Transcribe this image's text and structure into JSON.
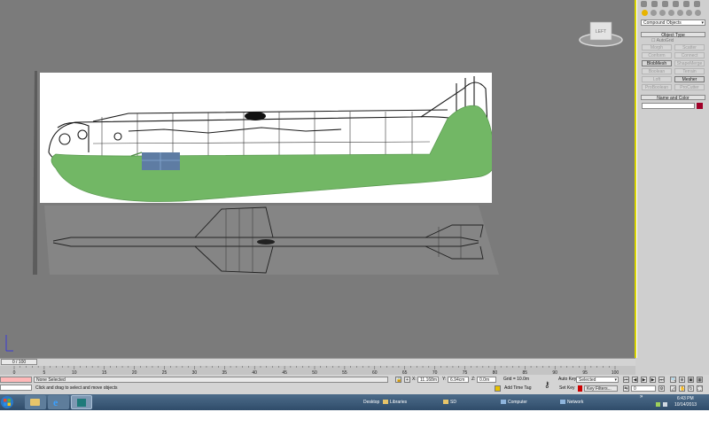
{
  "viewport": {
    "label": "",
    "viewcube_label": "LEFT"
  },
  "command_panel": {
    "category_dropdown": "Compound Objects",
    "object_type_header": "Object Type",
    "autogrid_label": "AutoGrid",
    "buttons": [
      {
        "label": "Morph",
        "enabled": false
      },
      {
        "label": "Scatter",
        "enabled": false
      },
      {
        "label": "Conform",
        "enabled": false
      },
      {
        "label": "Connect",
        "enabled": false
      },
      {
        "label": "BlobMesh",
        "enabled": true
      },
      {
        "label": "ShapeMerge",
        "enabled": false
      },
      {
        "label": "Boolean",
        "enabled": false
      },
      {
        "label": "Terrain",
        "enabled": false
      },
      {
        "label": "Loft",
        "enabled": false
      },
      {
        "label": "Mesher",
        "enabled": true
      },
      {
        "label": "ProBoolean",
        "enabled": false
      },
      {
        "label": "ProCutter",
        "enabled": false
      }
    ],
    "name_color_header": "Name and Color",
    "object_color": "#a00028"
  },
  "timeline": {
    "slider_label": "0 / 100",
    "ticks": [
      "0",
      "5",
      "10",
      "15",
      "20",
      "25",
      "30",
      "35",
      "40",
      "45",
      "50",
      "55",
      "60",
      "65",
      "70",
      "75",
      "80",
      "85",
      "90",
      "95",
      "100"
    ]
  },
  "status": {
    "selection": "None Selected",
    "prompt": "Click and drag to select and move objects",
    "x_label": "X:",
    "x_value": "11.168m",
    "y_label": "Y:",
    "y_value": "6.94cm",
    "z_label": "Z:",
    "z_value": "0.0m",
    "grid": "Grid = 10.0m",
    "add_time_tag": "Add Time Tag",
    "auto_key": "Auto Key",
    "selected_dropdown": "Selected",
    "set_key": "Set Key",
    "key_filters": "Key Filters...",
    "frame": "0"
  },
  "taskbar": {
    "desktop": "Desktop",
    "libraries": "Libraries",
    "folder": "SD",
    "computer": "Computer",
    "network": "Network",
    "time": "6:43 PM",
    "date": "10/14/2013"
  },
  "colors": {
    "viewport_bg": "#7b7b7b",
    "fuselage_green": "#72b765",
    "canopy_blue": "#5e7ca3",
    "taskbar": "#3c5a78"
  }
}
